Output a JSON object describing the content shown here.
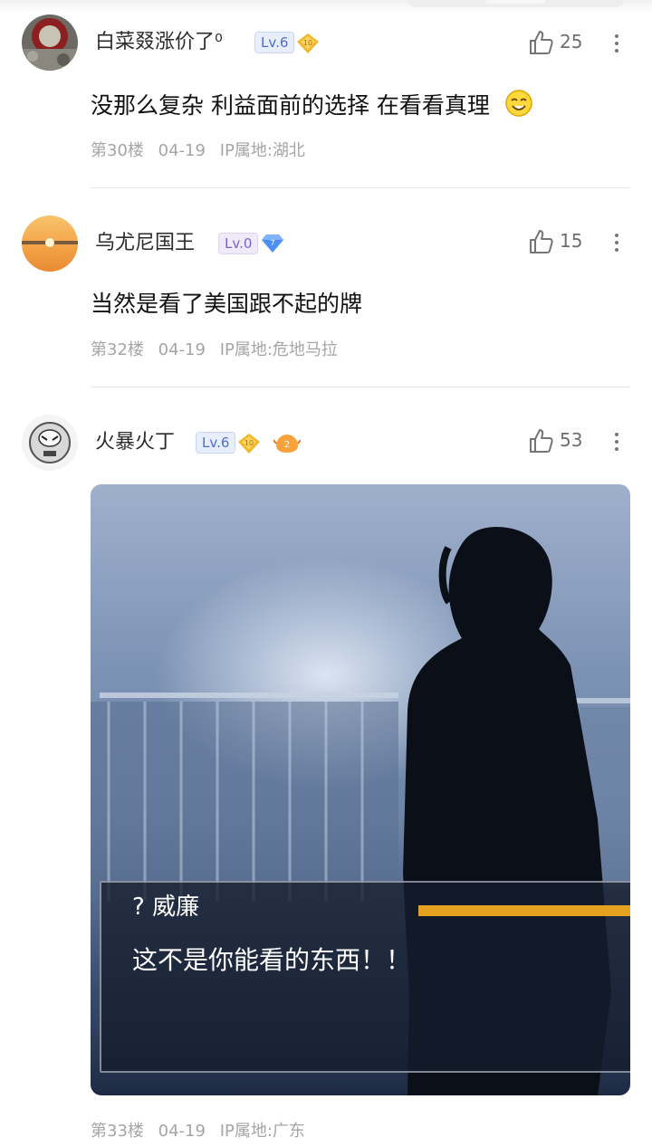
{
  "posts": [
    {
      "username": "白菜叕涨价了⁰",
      "level": "Lv.6",
      "badge_number": "10",
      "likes": "25",
      "text": "没那么复杂 利益面前的选择 在看看真理",
      "emoji": "smile-emoji-icon",
      "floor": "第30楼",
      "date": "04-19",
      "ip": "IP属地:湖北"
    },
    {
      "username": "乌尤尼国王",
      "level": "Lv.0",
      "badge_number": "7",
      "likes": "15",
      "text": "当然是看了美国跟不起的牌",
      "floor": "第32楼",
      "date": "04-19",
      "ip": "IP属地:危地马拉"
    },
    {
      "username": "火暴火丁",
      "level": "Lv.6",
      "badge_number": "10",
      "extra_badge": "2",
      "likes": "53",
      "image_speaker": "? 威廉",
      "image_text": "这不是你能看的东西！！",
      "floor": "第33楼",
      "date": "04-19",
      "ip": "IP属地:广东"
    }
  ],
  "colors": {
    "level_blue": "#4a6fce",
    "level_purple": "#7b64c6",
    "badge_gold": "#f2b62c",
    "badge_diamond": "#4c8ef5",
    "meta_gray": "#a5a5a5"
  }
}
